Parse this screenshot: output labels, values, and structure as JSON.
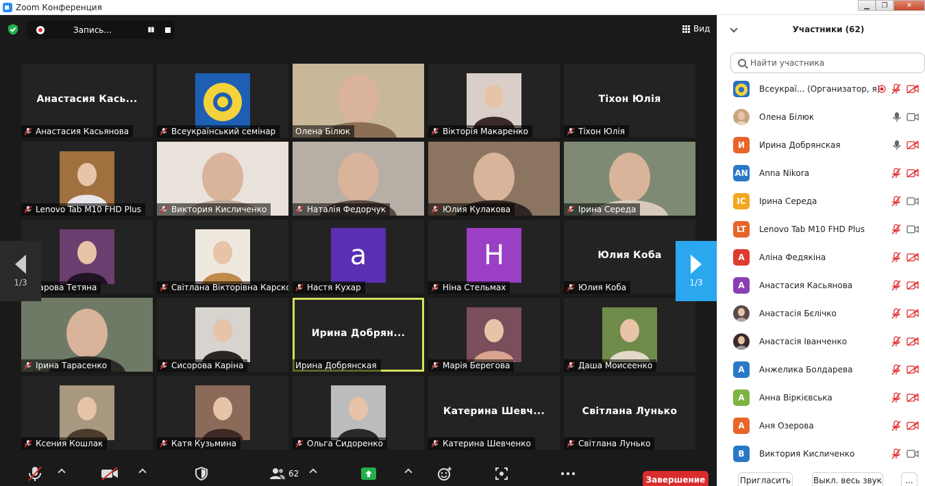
{
  "window": {
    "title": "Zoom Конференция",
    "min": "▁",
    "max": "❐",
    "close": "✕"
  },
  "recording": {
    "label": "Запись...",
    "pause": "▮▮"
  },
  "view": {
    "label": "Вид"
  },
  "tiles": [
    {
      "name": "Анастасия Касьянова",
      "big": "Анастасия  Кась...",
      "kind": "name",
      "muted": true
    },
    {
      "name": "Всеукраїнський семінар",
      "kind": "logo",
      "muted": true
    },
    {
      "name": "Олена Білюк",
      "kind": "cam",
      "colors": [
        "#c9b79a",
        "#8a6f55"
      ],
      "muted": false
    },
    {
      "name": "Вікторія Макаренко",
      "kind": "photo",
      "colors": [
        "#d9cfc8",
        "#3a2a2a"
      ],
      "muted": true
    },
    {
      "name": "Тіхон Юлія",
      "big": "Тіхон Юлія",
      "kind": "name",
      "muted": true
    },
    {
      "name": "Lenovo Tab M10 FHD Plus",
      "kind": "photo",
      "colors": [
        "#a0713e",
        "#e8e4ea"
      ],
      "muted": true
    },
    {
      "name": "Виктория Кисличенко",
      "kind": "cam",
      "colors": [
        "#e9e2da",
        "#b9a79a"
      ],
      "muted": true
    },
    {
      "name": "Наталія Федорчук",
      "kind": "cam",
      "colors": [
        "#b7aea6",
        "#5a4a44"
      ],
      "muted": true
    },
    {
      "name": "Юлия Кулакова",
      "kind": "cam",
      "colors": [
        "#8b7561",
        "#2e2622"
      ],
      "muted": true
    },
    {
      "name": "Ірина Середа",
      "kind": "cam",
      "colors": [
        "#7f8a74",
        "#d7c9bd"
      ],
      "muted": true
    },
    {
      "name": "Татарова Тетяна",
      "kind": "photo",
      "colors": [
        "#6a3e6e",
        "#201424"
      ],
      "muted": false
    },
    {
      "name": "Світлана Вікторівна Карско...",
      "kind": "photo",
      "colors": [
        "#efe8df",
        "#c08a4a"
      ],
      "muted": true
    },
    {
      "name": "Настя Кухар",
      "kind": "avatar",
      "letter": "a",
      "color": "#5a2fb2",
      "muted": true
    },
    {
      "name": "Ніна Стельмах",
      "kind": "avatar",
      "letter": "Н",
      "color": "#9b3fc4",
      "muted": true
    },
    {
      "name": "Юлия Коба",
      "big": "Юлия Коба",
      "kind": "name",
      "muted": true
    },
    {
      "name": "Ірина Тарасенко",
      "kind": "cam",
      "colors": [
        "#6f7a66",
        "#2b2a26"
      ],
      "muted": true
    },
    {
      "name": "Сисорова Каріна",
      "kind": "photo",
      "colors": [
        "#d7d3ce",
        "#2c2623"
      ],
      "muted": true
    },
    {
      "name": "Ирина Добрянская",
      "big": "Ирина  Добрян...",
      "kind": "name",
      "active": true,
      "muted": false
    },
    {
      "name": "Марія Берегова",
      "kind": "photo",
      "colors": [
        "#7a4e5a",
        "#d9a58e"
      ],
      "muted": true
    },
    {
      "name": "Даша Моисеенко",
      "kind": "photo",
      "colors": [
        "#6f8b4a",
        "#e3d9c8"
      ],
      "muted": true
    },
    {
      "name": "Ксения Кошлак",
      "kind": "photo",
      "colors": [
        "#a89880",
        "#4b3c2e"
      ],
      "muted": true
    },
    {
      "name": "Катя Кузьмина",
      "kind": "photo",
      "colors": [
        "#8c6a5a",
        "#3e2a24"
      ],
      "muted": true
    },
    {
      "name": "Ольга Сидоренко",
      "kind": "photo",
      "colors": [
        "#bcbcbc",
        "#2a2a2a"
      ],
      "muted": true
    },
    {
      "name": "Катерина Шевченко",
      "big": "Катерина  Шевч...",
      "kind": "name",
      "muted": true
    },
    {
      "name": "Світлана Лунько",
      "big": "Світлана Лунько",
      "kind": "name",
      "muted": true
    }
  ],
  "pager": {
    "left": "1/3",
    "right": "1/3"
  },
  "toolbar": {
    "participants_count": "62",
    "end": "Завершение"
  },
  "panel": {
    "title": "Участники (62)",
    "search_placeholder": "Найти участника",
    "participants": [
      {
        "name": "Всеукраї...  (Организатор, я)",
        "avatar": "logo",
        "color": "#2a6fc2",
        "rec": true,
        "mic": "muted",
        "video": "off"
      },
      {
        "name": "Олена Білюк",
        "avatar": "photo",
        "color": "#c8a57e",
        "mic": "on",
        "video": "on"
      },
      {
        "name": "Ирина Добрянская",
        "avatar": "И",
        "color": "#e8642a",
        "mic": "on",
        "video": "off"
      },
      {
        "name": "Anna Nikora",
        "avatar": "AN",
        "color": "#2a78c8",
        "mic": "muted",
        "video": "off"
      },
      {
        "name": "Ірина Середа",
        "avatar": "IC",
        "color": "#f2a81e",
        "mic": "muted",
        "video": "on"
      },
      {
        "name": "Lenovo Tab M10 FHD Plus",
        "avatar": "LT",
        "color": "#e8642a",
        "mic": "muted",
        "video": "on"
      },
      {
        "name": "Аліна Федякіна",
        "avatar": "А",
        "color": "#e03a2f",
        "mic": "muted",
        "video": "off"
      },
      {
        "name": "Анастасия Касьянова",
        "avatar": "А",
        "color": "#8a3fb5",
        "mic": "muted",
        "video": "off"
      },
      {
        "name": "Анастасія Бєлічко",
        "avatar": "photo",
        "color": "#5a4a4a",
        "mic": "muted",
        "video": "off"
      },
      {
        "name": "Анастасія Іванченко",
        "avatar": "photo",
        "color": "#3a2a2a",
        "mic": "muted",
        "video": "off"
      },
      {
        "name": "Анжелика Болдарева",
        "avatar": "А",
        "color": "#2a78c8",
        "mic": "muted",
        "video": "off"
      },
      {
        "name": "Анна Віркієвська",
        "avatar": "А",
        "color": "#7cb342",
        "mic": "muted",
        "video": "off"
      },
      {
        "name": "Аня Озерова",
        "avatar": "А",
        "color": "#e8642a",
        "mic": "muted",
        "video": "off"
      },
      {
        "name": "Виктория Кисличенко",
        "avatar": "В",
        "color": "#2a78c8",
        "mic": "muted",
        "video": "on"
      }
    ],
    "invite": "Пригласить",
    "mute_all": "Выкл. весь звук",
    "more": "..."
  }
}
